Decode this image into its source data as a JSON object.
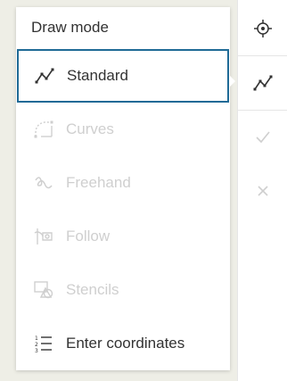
{
  "panel": {
    "title": "Draw mode",
    "items": [
      {
        "label": "Standard",
        "icon": "polyline-icon",
        "state": "selected"
      },
      {
        "label": "Curves",
        "icon": "curve-icon",
        "state": "disabled"
      },
      {
        "label": "Freehand",
        "icon": "freehand-icon",
        "state": "disabled"
      },
      {
        "label": "Follow",
        "icon": "follow-icon",
        "state": "disabled"
      },
      {
        "label": "Stencils",
        "icon": "stencils-icon",
        "state": "disabled"
      },
      {
        "label": "Enter coordinates",
        "icon": "coordinates-list-icon",
        "state": "enabled"
      }
    ]
  },
  "toolbar": {
    "buttons": [
      {
        "icon": "crosshair-icon",
        "state": "enabled"
      },
      {
        "icon": "polyline-icon",
        "state": "enabled"
      },
      {
        "icon": "checkmark-icon",
        "state": "disabled"
      },
      {
        "icon": "close-icon",
        "state": "disabled"
      }
    ]
  },
  "colors": {
    "background": "#eeeee6",
    "panel": "#ffffff",
    "selection_border": "#1f6a96",
    "text": "#323232",
    "disabled": "#cfcfcf"
  }
}
